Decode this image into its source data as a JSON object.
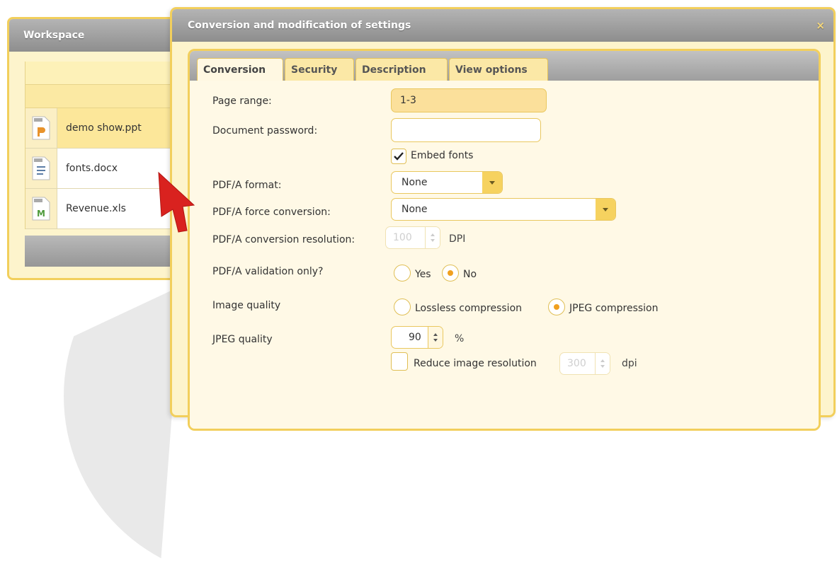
{
  "workspace": {
    "title": "Workspace",
    "files": [
      {
        "name": "demo show.ppt",
        "icon": "ppt-file-icon",
        "selected": true,
        "color": "#e8932c"
      },
      {
        "name": "fonts.docx",
        "icon": "docx-file-icon",
        "selected": false,
        "color": "#5b7da6"
      },
      {
        "name": "Revenue.xls",
        "icon": "xls-file-icon",
        "selected": false,
        "color": "#4e9a3a"
      }
    ]
  },
  "dialog": {
    "title": "Conversion and modification of settings",
    "close_icon": "×",
    "tabs": [
      {
        "label": "Conversion",
        "active": true
      },
      {
        "label": "Security",
        "active": false
      },
      {
        "label": "Description",
        "active": false
      },
      {
        "label": "View options",
        "active": false
      }
    ],
    "form": {
      "page_range": {
        "label": "Page range:",
        "value": "1-3"
      },
      "document_password": {
        "label": "Document password:",
        "value": ""
      },
      "embed_fonts": {
        "label": "Embed fonts",
        "checked": true
      },
      "pdfa_format": {
        "label": "PDF/A format:",
        "value": "None"
      },
      "pdfa_force_conversion": {
        "label": "PDF/A force conversion:",
        "value": "None"
      },
      "pdfa_conversion_resolution": {
        "label": "PDF/A conversion resolution:",
        "value": "100",
        "unit": "DPI",
        "disabled": true
      },
      "pdfa_validation_only": {
        "label": "PDF/A validation only?",
        "options": [
          "Yes",
          "No"
        ],
        "selected": "No"
      },
      "image_quality": {
        "label": "Image quality",
        "options": [
          "Lossless compression",
          "JPEG compression"
        ],
        "selected": "JPEG compression"
      },
      "jpeg_quality": {
        "label": "JPEG quality",
        "value": "90",
        "unit": "%"
      },
      "reduce_image_resolution": {
        "label": "Reduce image resolution",
        "checked": false,
        "value": "300",
        "unit": "dpi",
        "disabled": true
      }
    }
  },
  "colors": {
    "accent": "#f2cf5c",
    "header_gray": "#9e9e9e",
    "radio_dot": "#f0a020",
    "cursor": "#d9221f"
  }
}
